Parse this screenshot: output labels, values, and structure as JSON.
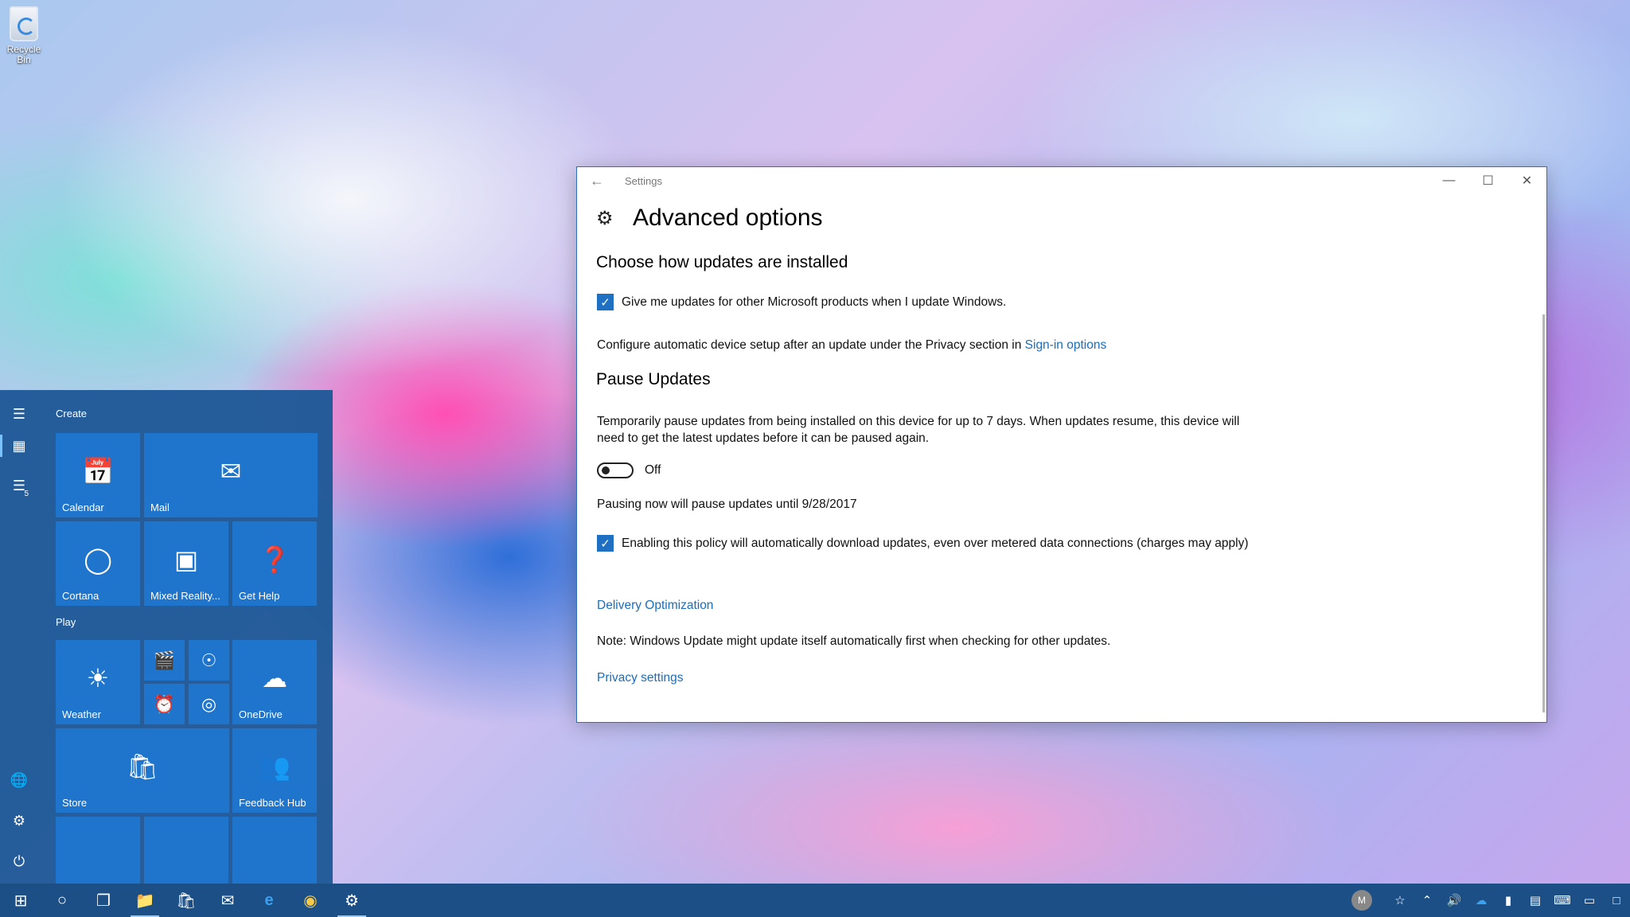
{
  "desktop": {
    "recycle_bin_label": "Recycle Bin"
  },
  "start_menu": {
    "groups": {
      "create": "Create",
      "play": "Play"
    },
    "rail_badge": "5",
    "tiles": {
      "calendar": "Calendar",
      "mail": "Mail",
      "cortana": "Cortana",
      "mixed_reality": "Mixed Reality...",
      "get_help": "Get Help",
      "weather": "Weather",
      "onedrive": "OneDrive",
      "store": "Store",
      "feedback_hub": "Feedback Hub"
    }
  },
  "settings": {
    "window_title": "Settings",
    "page_title": "Advanced options",
    "section_install": "Choose how updates are installed",
    "checkbox_other_products": "Give me updates for other Microsoft products when I update Windows.",
    "checkbox_other_products_checked": true,
    "device_setup_text": "Configure automatic device setup after an update under the Privacy section in",
    "sign_in_link": "Sign-in options",
    "section_pause": "Pause Updates",
    "pause_desc_line1": "Temporarily pause updates from being installed on this device for up to 7 days. When updates resume, this device will",
    "pause_desc_line2": "need to get the latest updates before it can be paused again.",
    "pause_toggle_state": "Off",
    "pause_until_text": "Pausing now will pause updates until 9/28/2017",
    "checkbox_metered": "Enabling this policy will automatically download updates, even over metered data connections (charges may apply)",
    "checkbox_metered_checked": true,
    "delivery_link": "Delivery Optimization",
    "note_text": "Note: Windows Update might update itself automatically first when checking for other updates.",
    "privacy_link": "Privacy settings"
  },
  "taskbar": {
    "avatar_initial": "M"
  },
  "colors": {
    "accent": "#1f6fc2",
    "link": "#1a6dbb",
    "start_bg": "#1e5896",
    "tile": "#1f74cc",
    "taskbar": "#1c4f86"
  }
}
